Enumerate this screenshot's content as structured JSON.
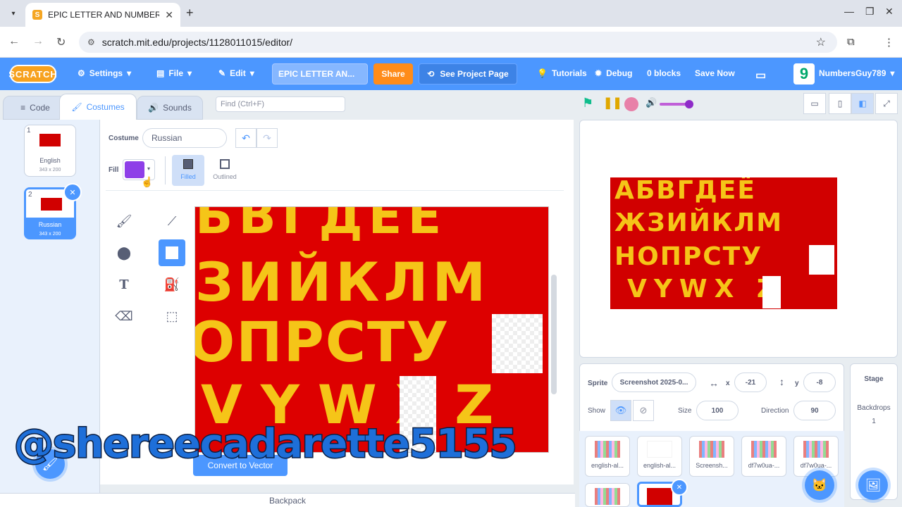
{
  "browser": {
    "tab_title": "EPIC LETTER AND NUMBER CH",
    "url": "scratch.mit.edu/projects/1128011015/editor/"
  },
  "menubar": {
    "logo": "SCRATCH",
    "settings": "Settings",
    "file": "File",
    "edit": "Edit",
    "project_title": "EPIC LETTER AN...",
    "share": "Share",
    "see_project_page": "See Project Page",
    "tutorials": "Tutorials",
    "debug": "Debug",
    "blocks": "0 blocks",
    "save_now": "Save Now",
    "avatar_letter": "9",
    "username": "NumbersGuy789"
  },
  "editor_tabs": {
    "code": "Code",
    "costumes": "Costumes",
    "sounds": "Sounds",
    "find_placeholder": "Find (Ctrl+F)"
  },
  "costumes": [
    {
      "num": "1",
      "name": "English",
      "size": "343 x 200"
    },
    {
      "num": "2",
      "name": "Russian",
      "size": "343 x 200"
    }
  ],
  "paint": {
    "costume_label": "Costume",
    "costume_name": "Russian",
    "fill_label": "Fill",
    "fill_color": "#8e3fe8",
    "filled": "Filled",
    "outlined": "Outlined",
    "canvas_rows": [
      "БВГДЕЁ",
      "ЗИЙКЛМ",
      "ОПРСТУ",
      "VYWXZ"
    ],
    "convert_label": "Convert to Vector"
  },
  "stage": {
    "rows": [
      "АБВГДЕЁ",
      "ЖЗИЙКЛМ",
      "НОПРСТУ",
      "VYWX Z"
    ]
  },
  "sprite_info": {
    "sprite_label": "Sprite",
    "sprite_name": "Screenshot 2025-0...",
    "x_label": "x",
    "x": "-21",
    "y_label": "y",
    "y": "-8",
    "show_label": "Show",
    "size_label": "Size",
    "size": "100",
    "direction_label": "Direction",
    "direction": "90"
  },
  "sprites": [
    {
      "name": "english-al..."
    },
    {
      "name": "english-al..."
    },
    {
      "name": "Screensh..."
    },
    {
      "name": "df7w0ua-..."
    },
    {
      "name": "df7w0ua-..."
    }
  ],
  "stage_panel": {
    "title": "Stage",
    "backdrops_label": "Backdrops",
    "backdrops_count": "1"
  },
  "backpack": "Backpack",
  "watermark": "@shereecadarette5155",
  "colors": {
    "scratch_blue": "#4c97ff",
    "share_orange": "#ff8c1a",
    "canvas_red": "#dd0000",
    "letter_yellow": "#f5c518"
  }
}
